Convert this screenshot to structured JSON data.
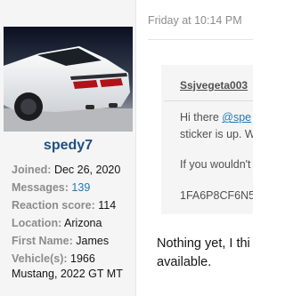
{
  "user": {
    "username": "spedy7",
    "stats": [
      {
        "label": "Joined:",
        "value": "Dec 26, 2020",
        "link": false
      },
      {
        "label": "Messages:",
        "value": "139",
        "link": true
      },
      {
        "label": "Reaction score:",
        "value": "114",
        "link": false
      },
      {
        "label": "Location:",
        "value": "Arizona",
        "link": false
      },
      {
        "label": "First Name:",
        "value": "James",
        "link": false
      }
    ],
    "vehicles_label": "Vehicle(s):",
    "vehicles_value": "1966 Mustang, 2022 GT MT"
  },
  "post": {
    "timestamp": "Friday at 10:14 PM",
    "quote": {
      "author": "Ssjvegeta003",
      "line1_prefix": "Hi there ",
      "line1_mention": "@spe",
      "line2": "sticker is up. W",
      "line3": "If you wouldn't",
      "line4": "1FA6P8CF6N5"
    },
    "body_line1": "Nothing yet, I thi",
    "body_line2": "available."
  }
}
